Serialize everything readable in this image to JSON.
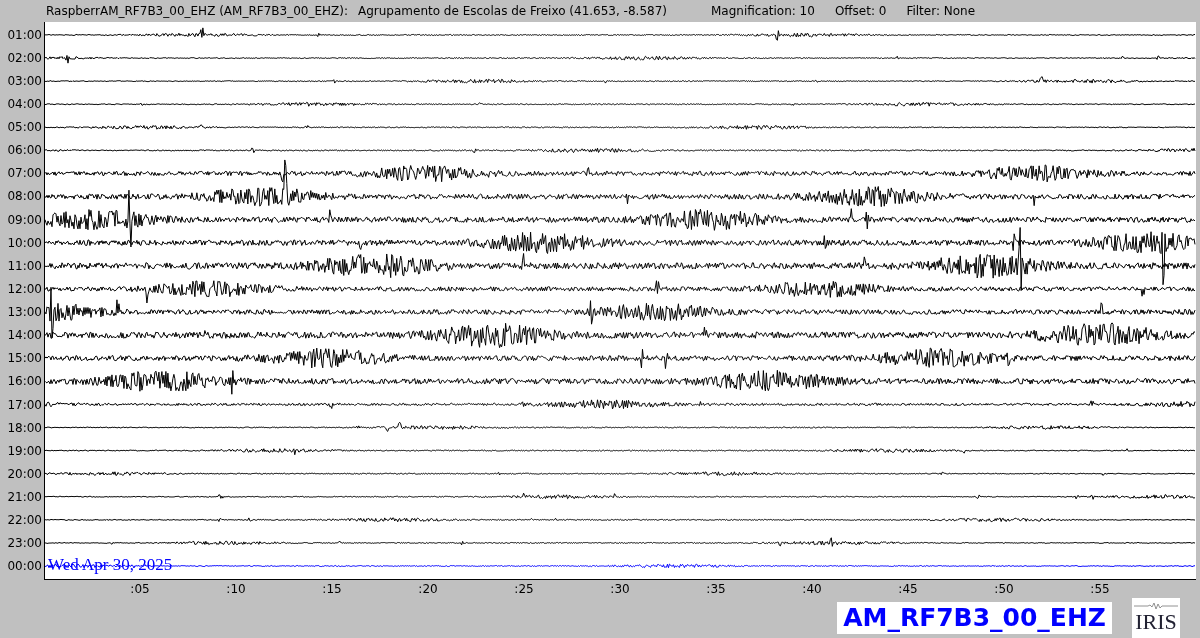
{
  "header": {
    "station": "RaspberrAM_RF7B3_00_EHZ (AM_RF7B3_00_EHZ):",
    "location": "Agrupamento de Escolas de Freixo (41.653, -8.587)",
    "magnification": "Magnification: 10",
    "offset": "Offset: 0",
    "filter": "Filter: None"
  },
  "rows": [
    {
      "label": "01:00",
      "color": "#000000"
    },
    {
      "label": "02:00",
      "color": "#000000"
    },
    {
      "label": "03:00",
      "color": "#000000"
    },
    {
      "label": "04:00",
      "color": "#000000"
    },
    {
      "label": "05:00",
      "color": "#000000"
    },
    {
      "label": "06:00",
      "color": "#000000"
    },
    {
      "label": "07:00",
      "color": "#000000"
    },
    {
      "label": "08:00",
      "color": "#000000"
    },
    {
      "label": "09:00",
      "color": "#000000"
    },
    {
      "label": "10:00",
      "color": "#000000"
    },
    {
      "label": "11:00",
      "color": "#000000"
    },
    {
      "label": "12:00",
      "color": "#000000"
    },
    {
      "label": "13:00",
      "color": "#000000"
    },
    {
      "label": "14:00",
      "color": "#000000"
    },
    {
      "label": "15:00",
      "color": "#000000"
    },
    {
      "label": "16:00",
      "color": "#000000"
    },
    {
      "label": "17:00",
      "color": "#000000"
    },
    {
      "label": "18:00",
      "color": "#000000"
    },
    {
      "label": "19:00",
      "color": "#000000"
    },
    {
      "label": "20:00",
      "color": "#000000"
    },
    {
      "label": "21:00",
      "color": "#000000"
    },
    {
      "label": "22:00",
      "color": "#000000"
    },
    {
      "label": "23:00",
      "color": "#000000"
    },
    {
      "label": "00:00",
      "color": "#0000ff"
    }
  ],
  "date": "Wed Apr 30, 2025",
  "minute_ticks": [
    ":05",
    ":10",
    ":15",
    ":20",
    ":25",
    ":30",
    ":35",
    ":40",
    ":45",
    ":50",
    ":55"
  ],
  "channel_label": "AM_RF7B3_00_EHZ",
  "logo_text": "IRIS"
}
